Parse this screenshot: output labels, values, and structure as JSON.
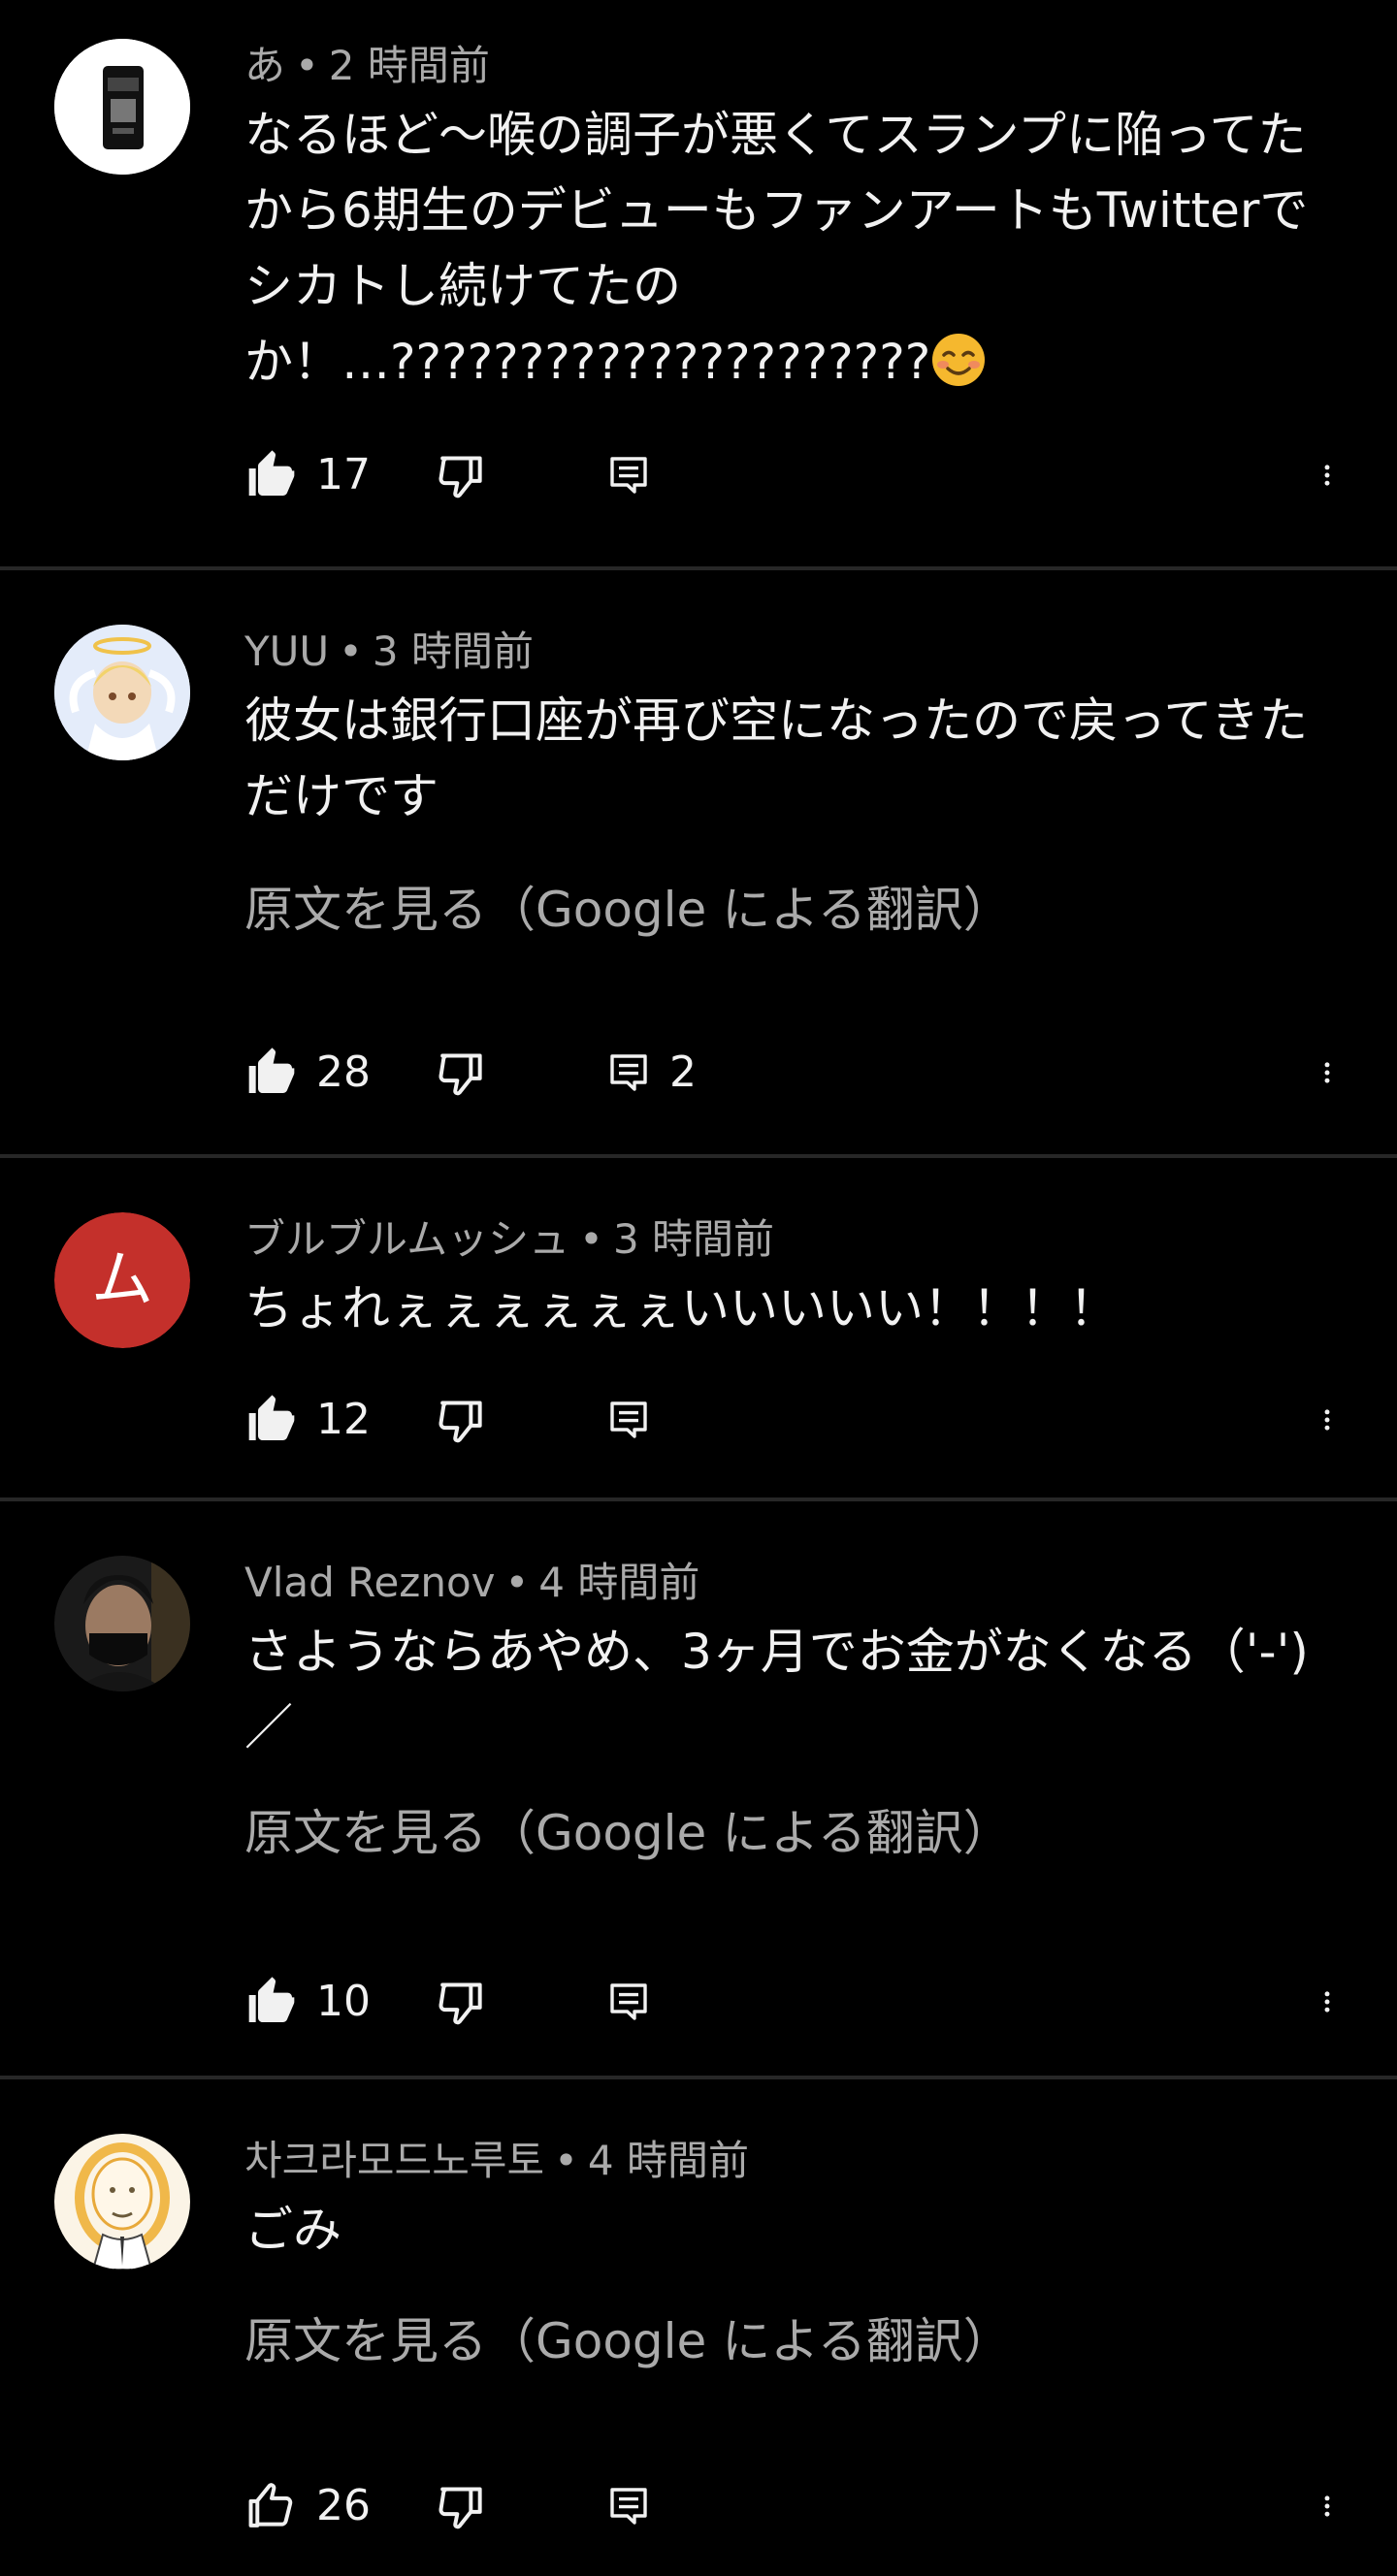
{
  "comments": [
    {
      "author": "あ",
      "time": "2 時間前",
      "text": "なるほど～喉の調子が悪くてスランプに陥ってたから6期生のデビューもファンアートもTwitterでシカトし続けてたのか！…?????????????????????",
      "emoji": "smiling-face-icon",
      "likes": "17",
      "replies": "",
      "translate": ""
    },
    {
      "author": "YUU",
      "time": "3 時間前",
      "text": "彼女は銀行口座が再び空になったので戻ってきただけです",
      "likes": "28",
      "replies": "2",
      "translate": "原文を見る（Google による翻訳）"
    },
    {
      "author": "ブルブルムッシュ",
      "time": "3 時間前",
      "text": "ちょれぇぇぇぇぇぇいいいいい！！！！",
      "avatar_letter": "ム",
      "likes": "12",
      "replies": "",
      "translate": ""
    },
    {
      "author": "Vlad Reznov",
      "time": "4 時間前",
      "text": "さようならあやめ、3ヶ月でお金がなくなる（'-')／",
      "likes": "10",
      "replies": "",
      "translate": "原文を見る（Google による翻訳）"
    },
    {
      "author": "차크라모드노루토",
      "time": "4 時間前",
      "text": "ごみ",
      "likes": "26",
      "replies": "",
      "translate": "原文を見る（Google による翻訳）"
    }
  ],
  "colors": {
    "background": "#000000",
    "text": "#f1f1f1",
    "secondary": "#aaaaaa",
    "divider": "#272727",
    "avatar_red": "#c4302b"
  },
  "icons": {
    "like": "thumbs-up-icon",
    "dislike": "thumbs-down-icon",
    "reply": "reply-icon",
    "more": "more-vertical-icon"
  }
}
